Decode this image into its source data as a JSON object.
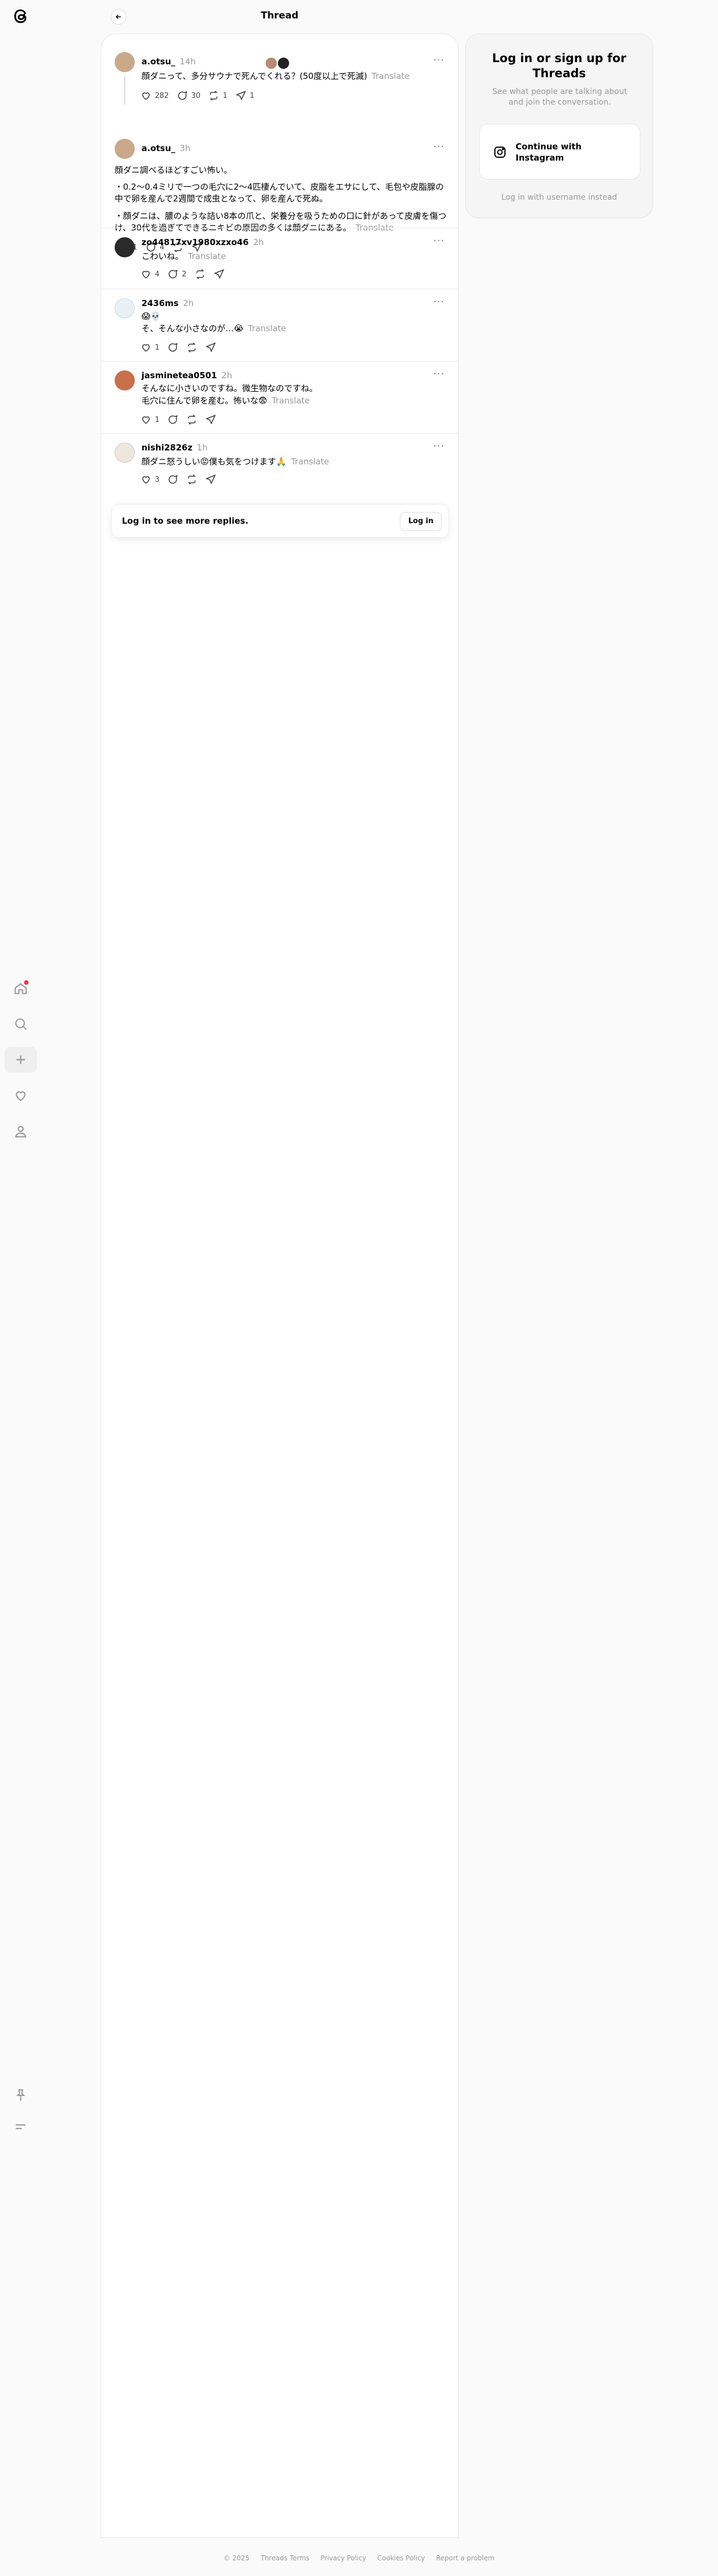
{
  "header": {
    "title": "Thread"
  },
  "posts": [
    {
      "username": "a.otsu_",
      "time": "14h",
      "text": "顔ダニって、多分サウナで死んでくれる？(50度以上で死滅)",
      "translate": "Translate",
      "likes": "282",
      "replies": "30",
      "reposts": "1",
      "shares": "1"
    },
    {
      "username": "a.otsu_",
      "time": "3h",
      "para1": "顔ダニ調べるほどすごい怖い。",
      "para2": "・0.2〜0.4ミリで一つの毛穴に2〜4匹棲んでいて、皮脂をエサにして、毛包や皮脂腺の中で卵を産んで2週間で成虫となって、卵を産んで死ぬ。",
      "para3": "・顔ダニは、膿のような詰い8本の爪と、栄養分を吸うための口に針があって皮膚を傷つけ、30代を過ぎてできるニキビの原因の多くは顔ダニにある。",
      "translate": "Translate",
      "likes": "51",
      "replies": "4"
    },
    {
      "username": "zo44817xv1980xzxo46",
      "time": "2h",
      "text": "こわいね。",
      "translate": "Translate",
      "likes": "4",
      "replies": "2"
    },
    {
      "username": "2436ms",
      "time": "2h",
      "line1": "😱💀",
      "line2": "そ、そんな小さなのが…😭",
      "translate": "Translate",
      "likes": "1"
    },
    {
      "username": "jasminetea0501",
      "time": "2h",
      "line1": "そんなに小さいのですね。微生物なのですね。",
      "line2": "毛穴に住んで卵を産む。怖いな😨",
      "translate": "Translate",
      "likes": "1"
    },
    {
      "username": "nishi2826z",
      "time": "1h",
      "text": "顔ダニ怒うしい😡僕も気をつけます🙏",
      "translate": "Translate",
      "likes": "3"
    }
  ],
  "login_replies": {
    "label": "Log in to see more replies.",
    "button": "Log in"
  },
  "login_card": {
    "title": "Log in or sign up for Threads",
    "subtitle": "See what people are talking about and join the conversation.",
    "ig_button": "Continue with Instagram",
    "alt": "Log in with username instead"
  },
  "footer": {
    "copyright": "© 2025",
    "terms": "Threads Terms",
    "privacy": "Privacy Policy",
    "cookies": "Cookies Policy",
    "report": "Report a problem"
  },
  "colors": {
    "notification": "#ff3040",
    "muted": "#999999"
  }
}
